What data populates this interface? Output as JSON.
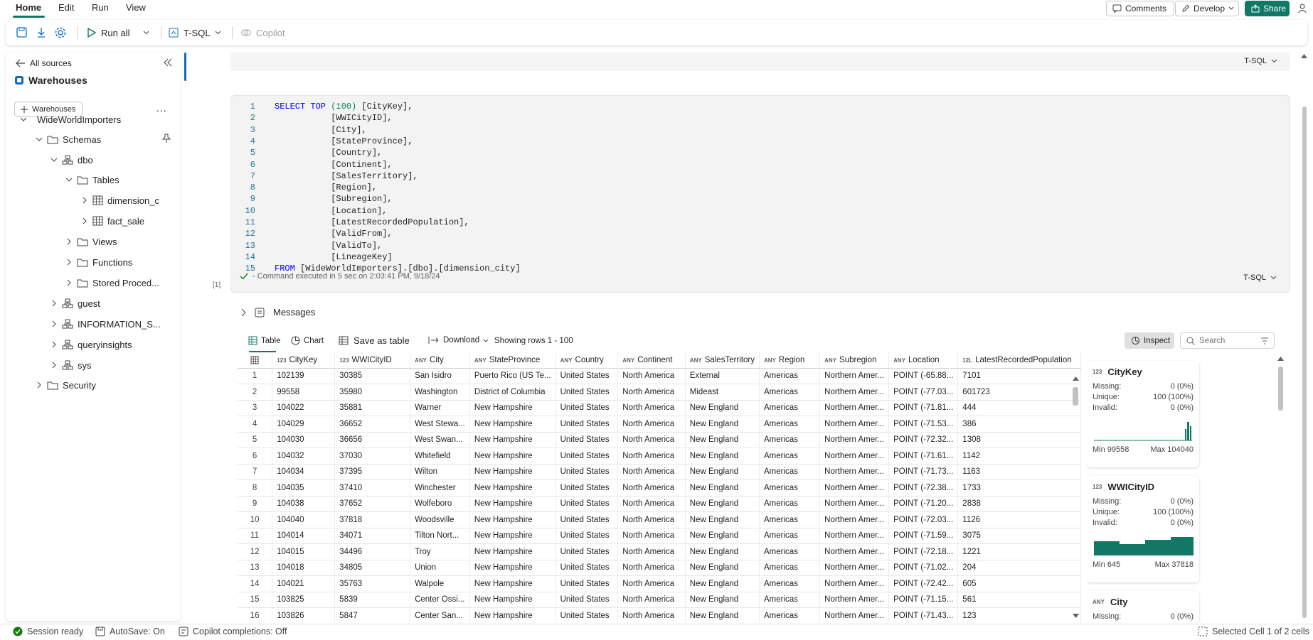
{
  "menu": {
    "tabs": [
      "Home",
      "Edit",
      "Run",
      "View"
    ],
    "comments": "Comments",
    "develop": "Develop",
    "share": "Share"
  },
  "toolbar": {
    "run_all": "Run all",
    "language": "T-SQL",
    "copilot": "Copilot"
  },
  "explorer": {
    "back": "All sources",
    "title": "Warehouses",
    "add_button": "Warehouses",
    "more": "...",
    "tree": {
      "db": "WideWorldImporters",
      "schemas": "Schemas",
      "dbo": "dbo",
      "tables": "Tables",
      "table1": "dimension_c",
      "table2": "fact_sale",
      "views": "Views",
      "functions": "Functions",
      "procs": "Stored Proced...",
      "guest": "guest",
      "info": "INFORMATION_S...",
      "qi": "queryinsights",
      "sys": "sys",
      "security": "Security"
    }
  },
  "editor": {
    "prev_lang": "T-SQL",
    "lines": [
      {
        "n": "1",
        "pre": "",
        "kw": "SELECT TOP ",
        "num": "(100)",
        "post": " [CityKey],"
      },
      {
        "n": "2",
        "pre": "           ",
        "kw": "",
        "num": "",
        "post": "[WWICityID],"
      },
      {
        "n": "3",
        "pre": "           ",
        "kw": "",
        "num": "",
        "post": "[City],"
      },
      {
        "n": "4",
        "pre": "           ",
        "kw": "",
        "num": "",
        "post": "[StateProvince],"
      },
      {
        "n": "5",
        "pre": "           ",
        "kw": "",
        "num": "",
        "post": "[Country],"
      },
      {
        "n": "6",
        "pre": "           ",
        "kw": "",
        "num": "",
        "post": "[Continent],"
      },
      {
        "n": "7",
        "pre": "           ",
        "kw": "",
        "num": "",
        "post": "[SalesTerritory],"
      },
      {
        "n": "8",
        "pre": "           ",
        "kw": "",
        "num": "",
        "post": "[Region],"
      },
      {
        "n": "9",
        "pre": "           ",
        "kw": "",
        "num": "",
        "post": "[Subregion],"
      },
      {
        "n": "10",
        "pre": "           ",
        "kw": "",
        "num": "",
        "post": "[Location],"
      },
      {
        "n": "11",
        "pre": "           ",
        "kw": "",
        "num": "",
        "post": "[LatestRecordedPopulation],"
      },
      {
        "n": "12",
        "pre": "           ",
        "kw": "",
        "num": "",
        "post": "[ValidFrom],"
      },
      {
        "n": "13",
        "pre": "           ",
        "kw": "",
        "num": "",
        "post": "[ValidTo],"
      },
      {
        "n": "14",
        "pre": "           ",
        "kw": "",
        "num": "",
        "post": "[LineageKey]"
      },
      {
        "n": "15",
        "pre": "",
        "kw": "FROM",
        "num": "",
        "post": " [WideWorldImporters].[dbo].[dimension_city]"
      }
    ],
    "exec_count": "[1]",
    "status": "- Command executed in 5 sec on 2:03:41 PM, 9/18/24",
    "lang": "T-SQL"
  },
  "messages": "Messages",
  "results": {
    "table_tab": "Table",
    "chart_tab": "Chart",
    "save_as_table": "Save as table",
    "download": "Download",
    "showing": "Showing rows 1 - 100",
    "inspect": "Inspect",
    "search_placeholder": "Search",
    "columns": [
      {
        "type": "123",
        "name": "CityKey"
      },
      {
        "type": "123",
        "name": "WWICityID"
      },
      {
        "type": "ANY",
        "name": "City"
      },
      {
        "type": "ANY",
        "name": "StateProvince"
      },
      {
        "type": "ANY",
        "name": "Country"
      },
      {
        "type": "ANY",
        "name": "Continent"
      },
      {
        "type": "ANY",
        "name": "SalesTerritory"
      },
      {
        "type": "ANY",
        "name": "Region"
      },
      {
        "type": "ANY",
        "name": "Subregion"
      },
      {
        "type": "ANY",
        "name": "Location"
      },
      {
        "type": "12L",
        "name": "LatestRecordedPopulation"
      }
    ],
    "rows": [
      [
        "1",
        "102139",
        "30385",
        "San Isidro",
        "Puerto Rico (US Te...",
        "United States",
        "North America",
        "External",
        "Americas",
        "Northern Amer...",
        "POINT (-65.88...",
        "7101"
      ],
      [
        "2",
        "99558",
        "35980",
        "Washington",
        "District of Columbia",
        "United States",
        "North America",
        "Mideast",
        "Americas",
        "Northern Amer...",
        "POINT (-77.03...",
        "601723"
      ],
      [
        "3",
        "104022",
        "35881",
        "Warner",
        "New Hampshire",
        "United States",
        "North America",
        "New England",
        "Americas",
        "Northern Amer...",
        "POINT (-71.81...",
        "444"
      ],
      [
        "4",
        "104029",
        "36652",
        "West Stewa...",
        "New Hampshire",
        "United States",
        "North America",
        "New England",
        "Americas",
        "Northern Amer...",
        "POINT (-71.53...",
        "386"
      ],
      [
        "5",
        "104030",
        "36656",
        "West Swan...",
        "New Hampshire",
        "United States",
        "North America",
        "New England",
        "Americas",
        "Northern Amer...",
        "POINT (-72.32...",
        "1308"
      ],
      [
        "6",
        "104032",
        "37030",
        "Whitefield",
        "New Hampshire",
        "United States",
        "North America",
        "New England",
        "Americas",
        "Northern Amer...",
        "POINT (-71.61...",
        "1142"
      ],
      [
        "7",
        "104034",
        "37395",
        "Wilton",
        "New Hampshire",
        "United States",
        "North America",
        "New England",
        "Americas",
        "Northern Amer...",
        "POINT (-71.73...",
        "1163"
      ],
      [
        "8",
        "104035",
        "37410",
        "Winchester",
        "New Hampshire",
        "United States",
        "North America",
        "New England",
        "Americas",
        "Northern Amer...",
        "POINT (-72.38...",
        "1733"
      ],
      [
        "9",
        "104038",
        "37652",
        "Wolfeboro",
        "New Hampshire",
        "United States",
        "North America",
        "New England",
        "Americas",
        "Northern Amer...",
        "POINT (-71.20...",
        "2838"
      ],
      [
        "10",
        "104040",
        "37818",
        "Woodsville",
        "New Hampshire",
        "United States",
        "North America",
        "New England",
        "Americas",
        "Northern Amer...",
        "POINT (-72.03...",
        "1126"
      ],
      [
        "11",
        "104014",
        "34071",
        "Tilton Nort...",
        "New Hampshire",
        "United States",
        "North America",
        "New England",
        "Americas",
        "Northern Amer...",
        "POINT (-71.59...",
        "3075"
      ],
      [
        "12",
        "104015",
        "34496",
        "Troy",
        "New Hampshire",
        "United States",
        "North America",
        "New England",
        "Americas",
        "Northern Amer...",
        "POINT (-72.18...",
        "1221"
      ],
      [
        "13",
        "104018",
        "34805",
        "Union",
        "New Hampshire",
        "United States",
        "North America",
        "New England",
        "Americas",
        "Northern Amer...",
        "POINT (-71.02...",
        "204"
      ],
      [
        "14",
        "104021",
        "35763",
        "Walpole",
        "New Hampshire",
        "United States",
        "North America",
        "New England",
        "Americas",
        "Northern Amer...",
        "POINT (-72.42...",
        "605"
      ],
      [
        "15",
        "103825",
        "5839",
        "Center Ossi...",
        "New Hampshire",
        "United States",
        "North America",
        "New England",
        "Americas",
        "Northern Amer...",
        "POINT (-71.15...",
        "561"
      ],
      [
        "16",
        "103826",
        "5847",
        "Center San...",
        "New Hampshire",
        "United States",
        "North America",
        "New England",
        "Americas",
        "Northern Amer...",
        "POINT (-71.43...",
        "123"
      ]
    ]
  },
  "inspect_cards": [
    {
      "type": "123",
      "name": "CityKey",
      "missing_label": "Missing:",
      "missing": "0 (0%)",
      "unique_label": "Unique:",
      "unique": "100 (100%)",
      "invalid_label": "Invalid:",
      "invalid": "0 (0%)",
      "min": "Min 99558",
      "max": "Max 104040"
    },
    {
      "type": "123",
      "name": "WWICityID",
      "missing_label": "Missing:",
      "missing": "0 (0%)",
      "unique_label": "Unique:",
      "unique": "100 (100%)",
      "invalid_label": "Invalid:",
      "invalid": "0 (0%)",
      "min": "Min 645",
      "max": "Max 37818"
    },
    {
      "type": "ANY",
      "name": "City",
      "missing_label": "Missing:",
      "missing": "0 (0%)"
    }
  ],
  "statusbar": {
    "session": "Session ready",
    "autosave": "AutoSave: On",
    "copilot": "Copilot completions: Off",
    "selected": "Selected Cell 1 of 2 cells"
  },
  "colors": {
    "accent": "#117865",
    "keyword": "#0000ff",
    "number": "#098658",
    "linenum": "#237893"
  }
}
